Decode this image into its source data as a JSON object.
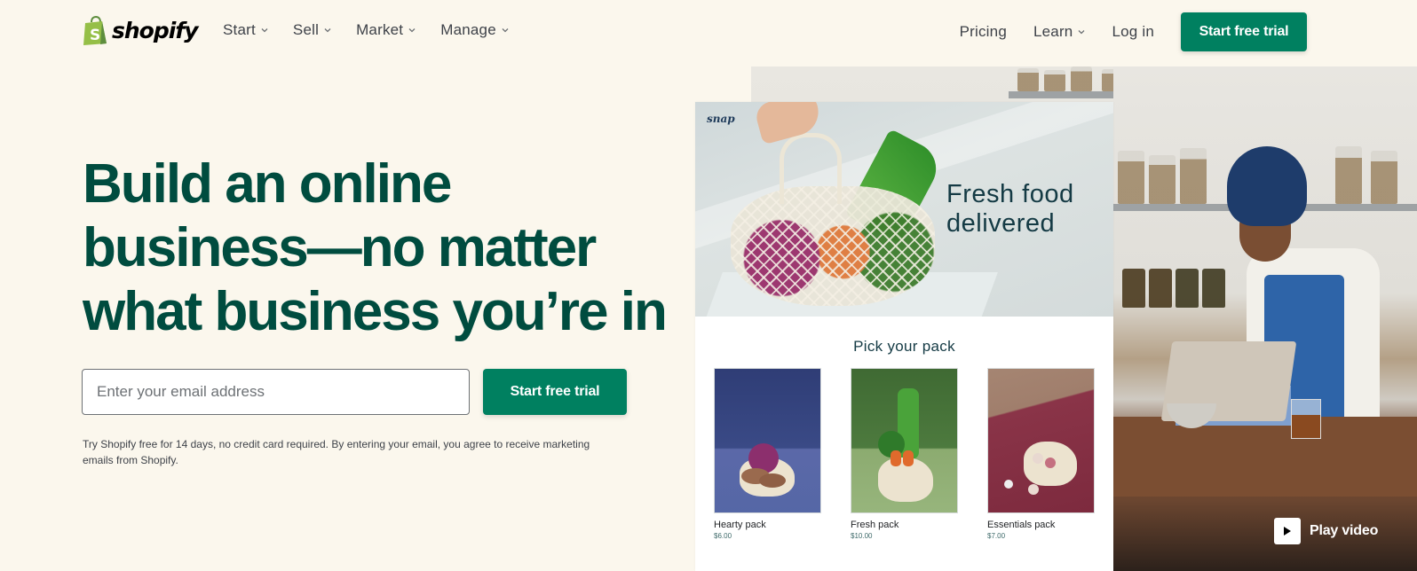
{
  "header": {
    "logo_text": "shopify",
    "nav_left": [
      {
        "label": "Start",
        "has_dropdown": true
      },
      {
        "label": "Sell",
        "has_dropdown": true
      },
      {
        "label": "Market",
        "has_dropdown": true
      },
      {
        "label": "Manage",
        "has_dropdown": true
      }
    ],
    "nav_right": [
      {
        "label": "Pricing",
        "has_dropdown": false
      },
      {
        "label": "Learn",
        "has_dropdown": true
      },
      {
        "label": "Log in",
        "has_dropdown": false
      }
    ],
    "cta_label": "Start free trial"
  },
  "hero": {
    "headline": "Build an online business—no matter what business you’re in",
    "email_placeholder": "Enter your email address",
    "email_value": "",
    "cta_label": "Start free trial",
    "disclaimer": "Try Shopify free for 14 days, no credit card required. By entering your email, you agree to receive marketing emails from Shopify."
  },
  "store_preview": {
    "brand": "snap",
    "banner_text": "Fresh food delivered",
    "section_title": "Pick your pack",
    "products": [
      {
        "name": "Hearty pack",
        "price": "$6.00"
      },
      {
        "name": "Fresh pack",
        "price": "$10.00"
      },
      {
        "name": "Essentials pack",
        "price": "$7.00"
      }
    ]
  },
  "video": {
    "play_label": "Play video",
    "icon": "play-icon"
  },
  "colors": {
    "brand_green": "#008060",
    "headline_green": "#004c3f",
    "page_background": "#fbf7ed",
    "logo_green": "#95bf47"
  }
}
